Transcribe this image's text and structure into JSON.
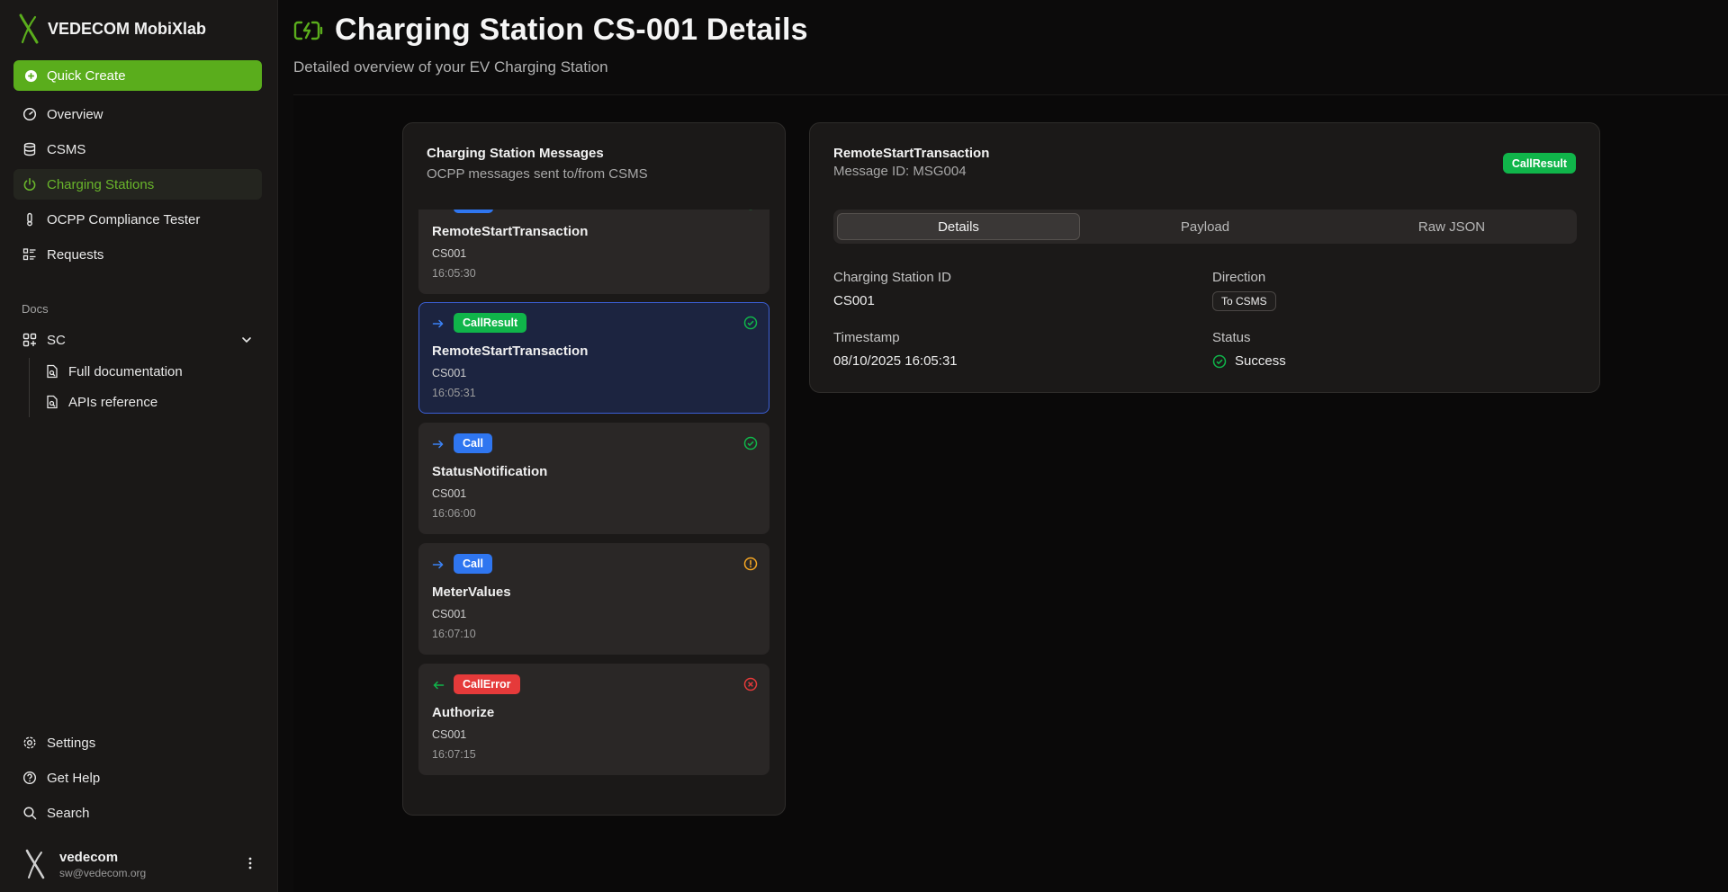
{
  "app": {
    "brand": "VEDECOM MobiXlab",
    "quick_create": "Quick Create"
  },
  "sidebar": {
    "items": [
      {
        "label": "Overview",
        "icon": "gauge-icon"
      },
      {
        "label": "CSMS",
        "icon": "database-icon"
      },
      {
        "label": "Charging Stations",
        "icon": "power-icon",
        "active": true
      },
      {
        "label": "OCPP Compliance Tester",
        "icon": "thermometer-icon"
      },
      {
        "label": "Requests",
        "icon": "list-icon"
      }
    ],
    "docs_label": "Docs",
    "group_label": "SC",
    "sub_items": [
      "Full documentation",
      "APIs reference"
    ],
    "footer_items": [
      "Settings",
      "Get Help",
      "Search"
    ],
    "user": {
      "name": "vedecom",
      "email": "sw@vedecom.org"
    }
  },
  "page": {
    "title": "Charging Station CS-001 Details",
    "subtitle": "Detailed overview of your EV Charging Station"
  },
  "messages_panel": {
    "title": "Charging Station Messages",
    "description": "OCPP messages sent to/from CSMS",
    "messages": [
      {
        "type": "",
        "name": "RemoteStartTransaction",
        "station": "CS001",
        "time": "16:05:30",
        "direction": "to",
        "status": "success"
      },
      {
        "type": "CallResult",
        "name": "RemoteStartTransaction",
        "station": "CS001",
        "time": "16:05:31",
        "direction": "to",
        "status": "success",
        "selected": true
      },
      {
        "type": "Call",
        "name": "StatusNotification",
        "station": "CS001",
        "time": "16:06:00",
        "direction": "to",
        "status": "success"
      },
      {
        "type": "Call",
        "name": "MeterValues",
        "station": "CS001",
        "time": "16:07:10",
        "direction": "to",
        "status": "warning"
      },
      {
        "type": "CallError",
        "name": "Authorize",
        "station": "CS001",
        "time": "16:07:15",
        "direction": "from",
        "status": "error"
      }
    ]
  },
  "detail": {
    "title": "RemoteStartTransaction",
    "message_id": "Message ID: MSG004",
    "badge": "CallResult",
    "tabs": [
      "Details",
      "Payload",
      "Raw JSON"
    ],
    "active_tab": "Details",
    "fields": {
      "station_label": "Charging Station ID",
      "station_value": "CS001",
      "direction_label": "Direction",
      "direction_value": "To CSMS",
      "timestamp_label": "Timestamp",
      "timestamp_value": "08/10/2025 16:05:31",
      "status_label": "Status",
      "status_value": "Success"
    }
  },
  "colors": {
    "accent": "#5aad1c",
    "call": "#2f76f0",
    "result": "#10b54a",
    "error": "#e53a3a",
    "warning": "#f5a623"
  }
}
